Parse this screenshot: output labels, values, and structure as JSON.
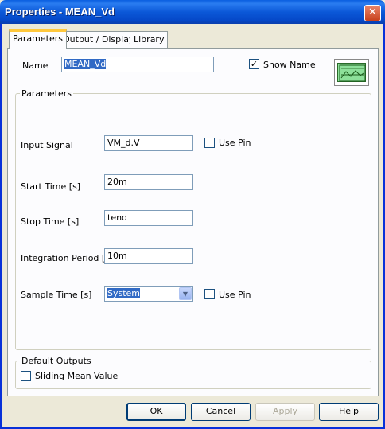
{
  "window": {
    "title": "Properties - MEAN_Vd",
    "close_glyph": "✕"
  },
  "tabs": [
    {
      "label": "Parameters",
      "active": true
    },
    {
      "label": "Output / Display",
      "active": false
    },
    {
      "label": "Library",
      "active": false
    }
  ],
  "name_row": {
    "label": "Name",
    "value": "MEAN_Vd",
    "show_name_label": "Show Name",
    "show_name_checked": true,
    "check_glyph": "✓"
  },
  "parameters": {
    "group_label": "Parameters",
    "input_signal": {
      "label": "Input Signal",
      "value": "VM_d.V",
      "use_pin_label": "Use Pin",
      "use_pin_checked": false
    },
    "start_time": {
      "label": "Start Time [s]",
      "value": "20m"
    },
    "stop_time": {
      "label": "Stop Time [s]",
      "value": "tend"
    },
    "integration_period": {
      "label": "Integration Period [s]",
      "value": "10m"
    },
    "sample_time": {
      "label": "Sample Time [s]",
      "value": "System",
      "arrow_glyph": "▼",
      "use_pin_label": "Use Pin",
      "use_pin_checked": false
    }
  },
  "default_outputs": {
    "group_label": "Default Outputs",
    "sliding_mean_label": "Sliding Mean Value",
    "sliding_mean_checked": false
  },
  "buttons": {
    "ok": "OK",
    "cancel": "Cancel",
    "apply": "Apply",
    "help": "Help"
  },
  "colors": {
    "title_bar": "#0b58d8",
    "dialog_bg": "#ece9d8",
    "panel_bg": "#fcfcfe",
    "selection": "#316ac5",
    "active_tab_accent": "#ffc83c"
  },
  "icons": [
    "close-icon",
    "block-preview-icon",
    "checkmark-icon",
    "dropdown-arrow-icon"
  ]
}
